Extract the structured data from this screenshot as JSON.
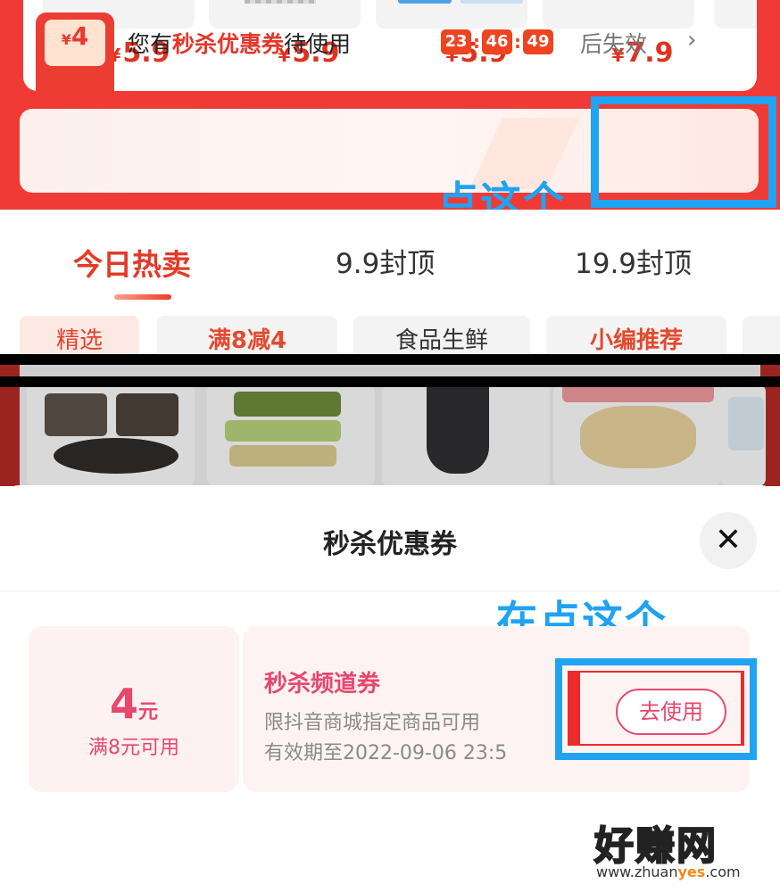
{
  "products_top": {
    "currency": "¥",
    "prices": [
      "5.9",
      "5.9",
      "5.9",
      "7.9"
    ]
  },
  "coupon_banner": {
    "envelope_currency": "¥",
    "envelope_amount": "4",
    "text_prefix": "您有",
    "text_highlight": "秒杀优惠券",
    "text_suffix": "待使用",
    "countdown": [
      "23",
      "46",
      "49"
    ],
    "expire_text": "后失效",
    "chevron": "›"
  },
  "annotations": {
    "note1": "点这个",
    "note2": "在点这个"
  },
  "tabs": [
    {
      "label": "今日热卖",
      "active": true
    },
    {
      "label": "9.9封顶",
      "active": false
    },
    {
      "label": "19.9封顶",
      "active": false
    }
  ],
  "chips": [
    "精选",
    "满8减4",
    "食品生鲜",
    "小编推荐"
  ],
  "sheet": {
    "title": "秒杀优惠券",
    "close_glyph": "✕"
  },
  "coupon": {
    "amount": "4",
    "unit": "元",
    "condition": "满8元可用",
    "name": "秒杀频道券",
    "description": "限抖音商城指定商品可用",
    "validity": "有效期至2022-09-06 23:5",
    "button": "去使用"
  },
  "watermark": {
    "main": "好赚网",
    "url_pre": "www.zhuan",
    "url_hl": "yes",
    "url_post": ".com"
  },
  "colors": {
    "brand_red": "#f03a35",
    "highlight_blue": "#1fa3f2",
    "coupon_pink": "#e8476e"
  }
}
